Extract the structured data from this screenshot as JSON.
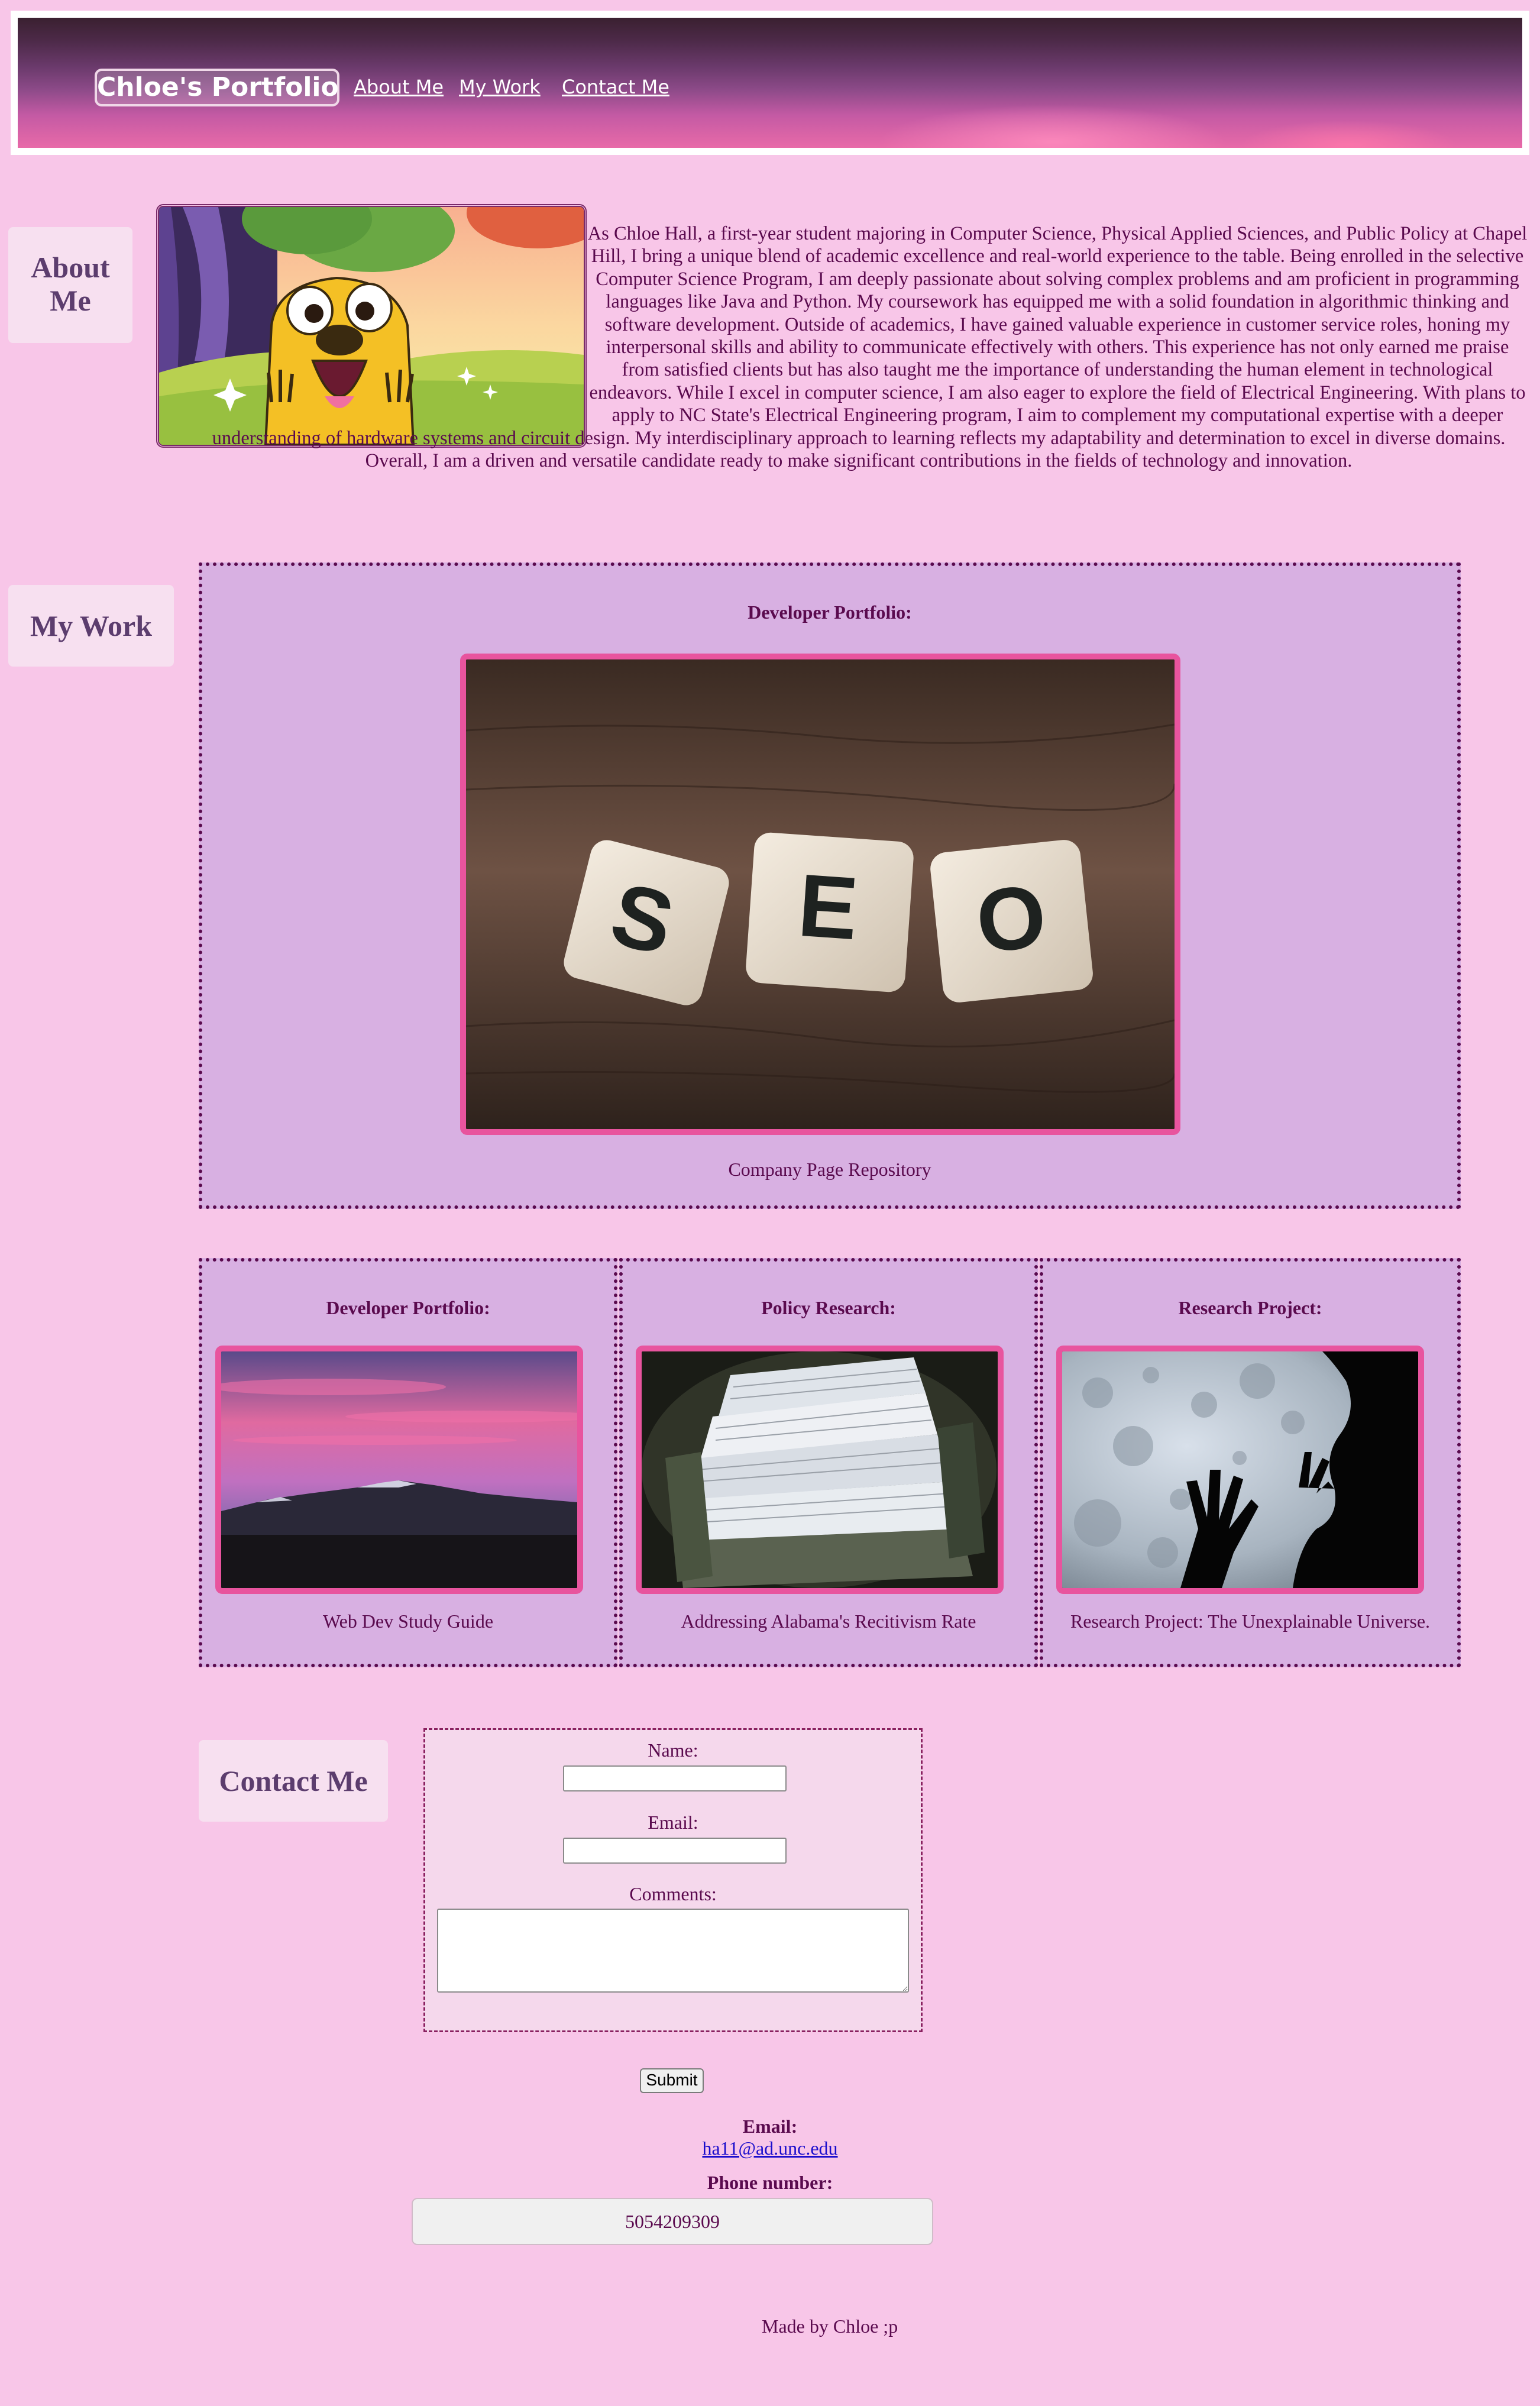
{
  "header": {
    "brand": "Chloe's Portfolio",
    "nav": [
      "About Me",
      "My Work",
      "Contact Me"
    ]
  },
  "about": {
    "title": "About Me",
    "image_icon": "cartoon-dog-image",
    "text": "As Chloe Hall, a first-year student majoring in Computer Science, Physical Applied Sciences, and Public Policy at Chapel Hill, I bring a unique blend of academic excellence and real-world experience to the table. Being enrolled in the selective Computer Science Program, I am deeply passionate about solving complex problems and am proficient in programming languages like Java and Python. My coursework has equipped me with a solid foundation in algorithmic thinking and software development. Outside of academics, I have gained valuable experience in customer service roles, honing my interpersonal skills and ability to communicate effectively with others. This experience has not only earned me praise from satisfied clients but has also taught me the importance of understanding the human element in technological endeavors. While I excel in computer science, I am also eager to explore the field of Electrical Engineering. With plans to apply to NC State's Electrical Engineering program, I aim to complement my computational expertise with a deeper understanding of hardware systems and circuit design. My interdisciplinary approach to learning reflects my adaptability and determination to excel in diverse domains. Overall, I am a driven and versatile candidate ready to make significant contributions in the fields of technology and innovation."
  },
  "work": {
    "title": "My Work",
    "featured": {
      "heading": "Developer Portfolio:",
      "caption": "Company Page Repository",
      "tiles": [
        "S",
        "E",
        "O"
      ]
    },
    "cards": [
      {
        "heading": "Developer Portfolio:",
        "caption": "Web Dev Study Guide"
      },
      {
        "heading": "Policy Research:",
        "caption": "Addressing Alabama's Recitivism Rate"
      },
      {
        "heading": "Research Project:",
        "caption": "Research Project: The Unexplainable Universe."
      }
    ]
  },
  "contact": {
    "title": "Contact Me",
    "form": {
      "name_label": "Name:",
      "name_value": "",
      "email_label": "Email:",
      "email_value": "",
      "comments_label": "Comments:",
      "comments_value": ""
    },
    "submit_label": "Submit",
    "email_heading": "Email:",
    "email_address": "ha11@ad.unc.edu",
    "phone_heading": "Phone number:",
    "phone_number": "5054209309"
  },
  "footer": {
    "text": "Made by Chloe ;p"
  },
  "colors": {
    "page_background": "#f8c6e8",
    "text": "#5a0a4e",
    "card_background": "#d8b0e2",
    "image_border": "#e8549e",
    "title_box": "#f7e0f0"
  }
}
